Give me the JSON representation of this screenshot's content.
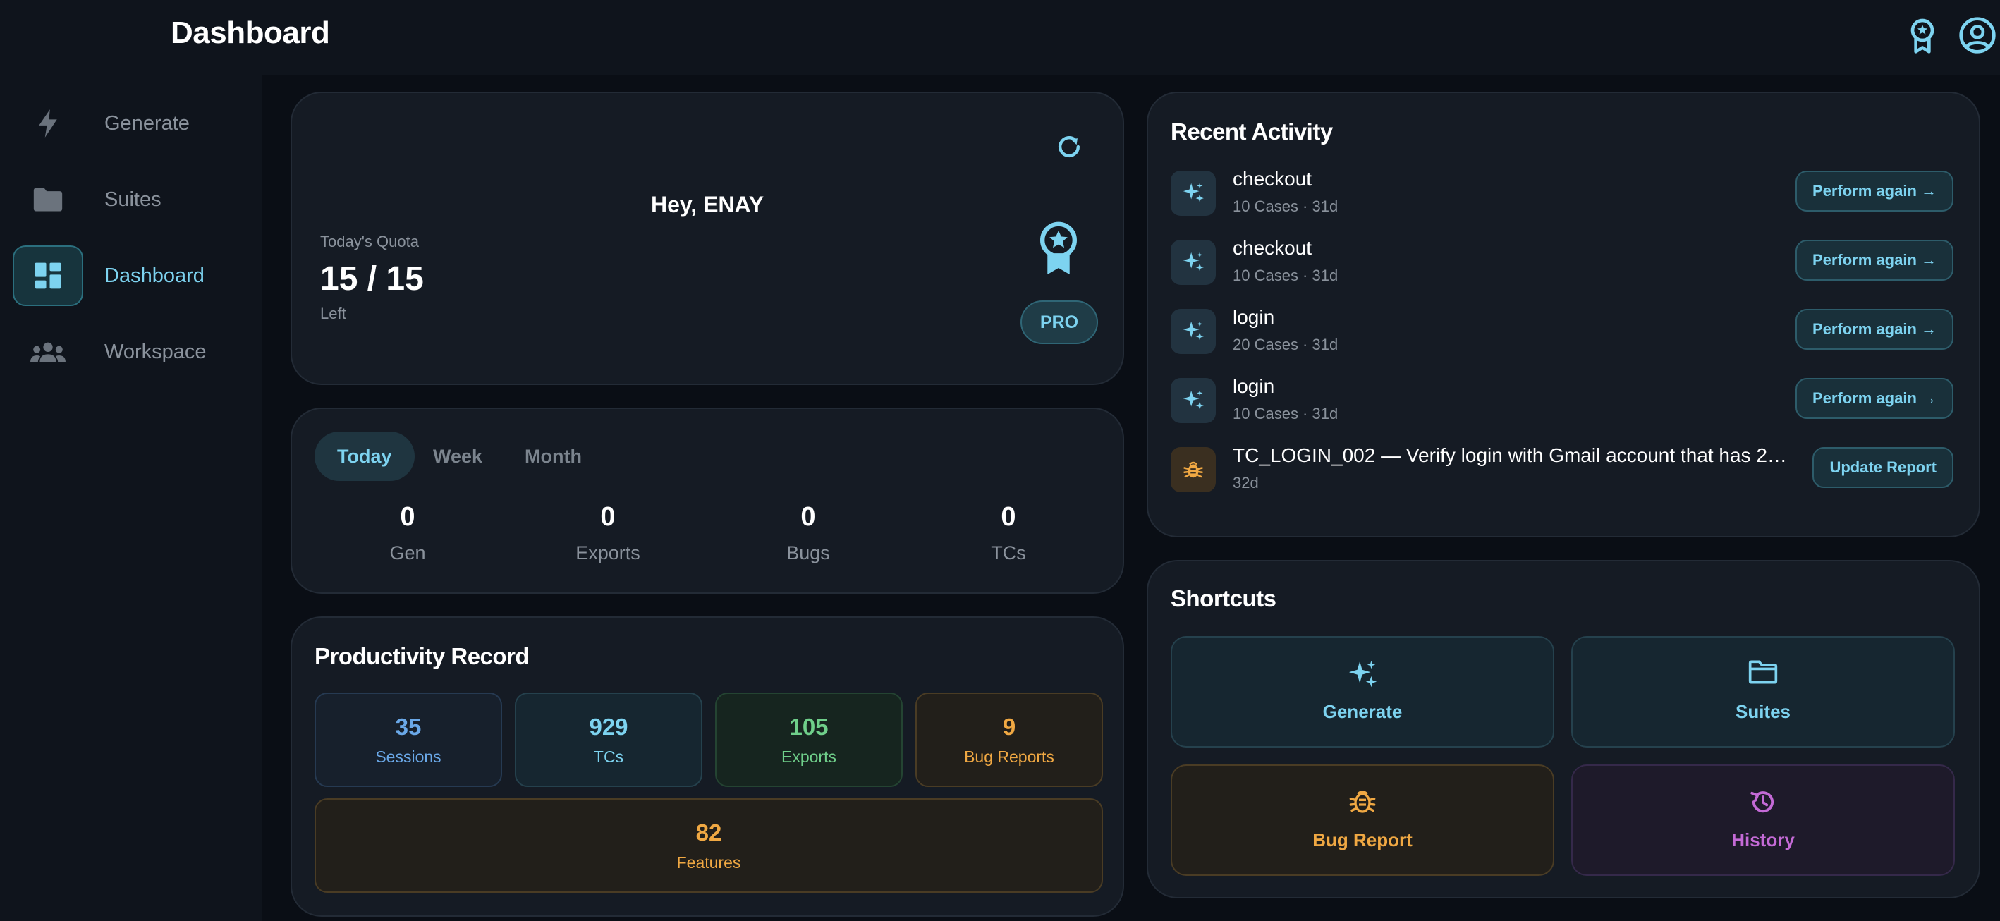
{
  "header": {
    "title": "Dashboard",
    "badge_icon": "award-badge-icon",
    "profile_icon": "account-circle-icon"
  },
  "sidebar": {
    "items": [
      {
        "label": "Generate",
        "icon": "bolt-icon",
        "active": false
      },
      {
        "label": "Suites",
        "icon": "folder-icon",
        "active": false
      },
      {
        "label": "Dashboard",
        "icon": "dashboard-grid-icon",
        "active": true
      },
      {
        "label": "Workspace",
        "icon": "group-icon",
        "active": false
      }
    ]
  },
  "quota": {
    "greeting": "Hey, ENAY",
    "label": "Today's Quota",
    "value": "15 / 15",
    "sub": "Left",
    "plan_badge": "PRO",
    "refresh_icon": "refresh-icon",
    "award_icon": "award-badge-icon"
  },
  "period": {
    "tabs": [
      "Today",
      "Week",
      "Month"
    ],
    "active_tab": "Today",
    "stats": [
      {
        "value": "0",
        "label": "Gen"
      },
      {
        "value": "0",
        "label": "Exports"
      },
      {
        "value": "0",
        "label": "Bugs"
      },
      {
        "value": "0",
        "label": "TCs"
      }
    ]
  },
  "productivity": {
    "title": "Productivity Record",
    "tiles": [
      {
        "value": "35",
        "label": "Sessions",
        "color": "#6aa8e8"
      },
      {
        "value": "929",
        "label": "TCs",
        "color": "#7dd3f0"
      },
      {
        "value": "105",
        "label": "Exports",
        "color": "#6fcf8a"
      },
      {
        "value": "9",
        "label": "Bug Reports",
        "color": "#f0a843"
      },
      {
        "value": "82",
        "label": "Features",
        "color": "#f0a843"
      }
    ]
  },
  "activity": {
    "title": "Recent Activity",
    "items": [
      {
        "title": "checkout",
        "meta": "10 Cases · 31d",
        "button": "Perform again →",
        "icon": "sparkle-icon"
      },
      {
        "title": "checkout",
        "meta": "10 Cases · 31d",
        "button": "Perform again →",
        "icon": "sparkle-icon"
      },
      {
        "title": "login",
        "meta": "20 Cases · 31d",
        "button": "Perform again →",
        "icon": "sparkle-icon"
      },
      {
        "title": "login",
        "meta": "10 Cases · 31d",
        "button": "Perform again →",
        "icon": "sparkle-icon"
      },
      {
        "title": "TC_LOGIN_002 — Verify login with Gmail account that has 2FA ena…",
        "meta": "32d",
        "button": "Update Report",
        "icon": "bug-icon"
      }
    ]
  },
  "shortcuts": {
    "title": "Shortcuts",
    "items": [
      {
        "label": "Generate",
        "icon": "sparkle-icon",
        "color": "#7dd3f0"
      },
      {
        "label": "Suites",
        "icon": "folder-outline-icon",
        "color": "#7dd3f0"
      },
      {
        "label": "Bug Report",
        "icon": "bug-icon",
        "color": "#f0a843"
      },
      {
        "label": "History",
        "icon": "history-icon",
        "color": "#c46ad6"
      }
    ]
  }
}
